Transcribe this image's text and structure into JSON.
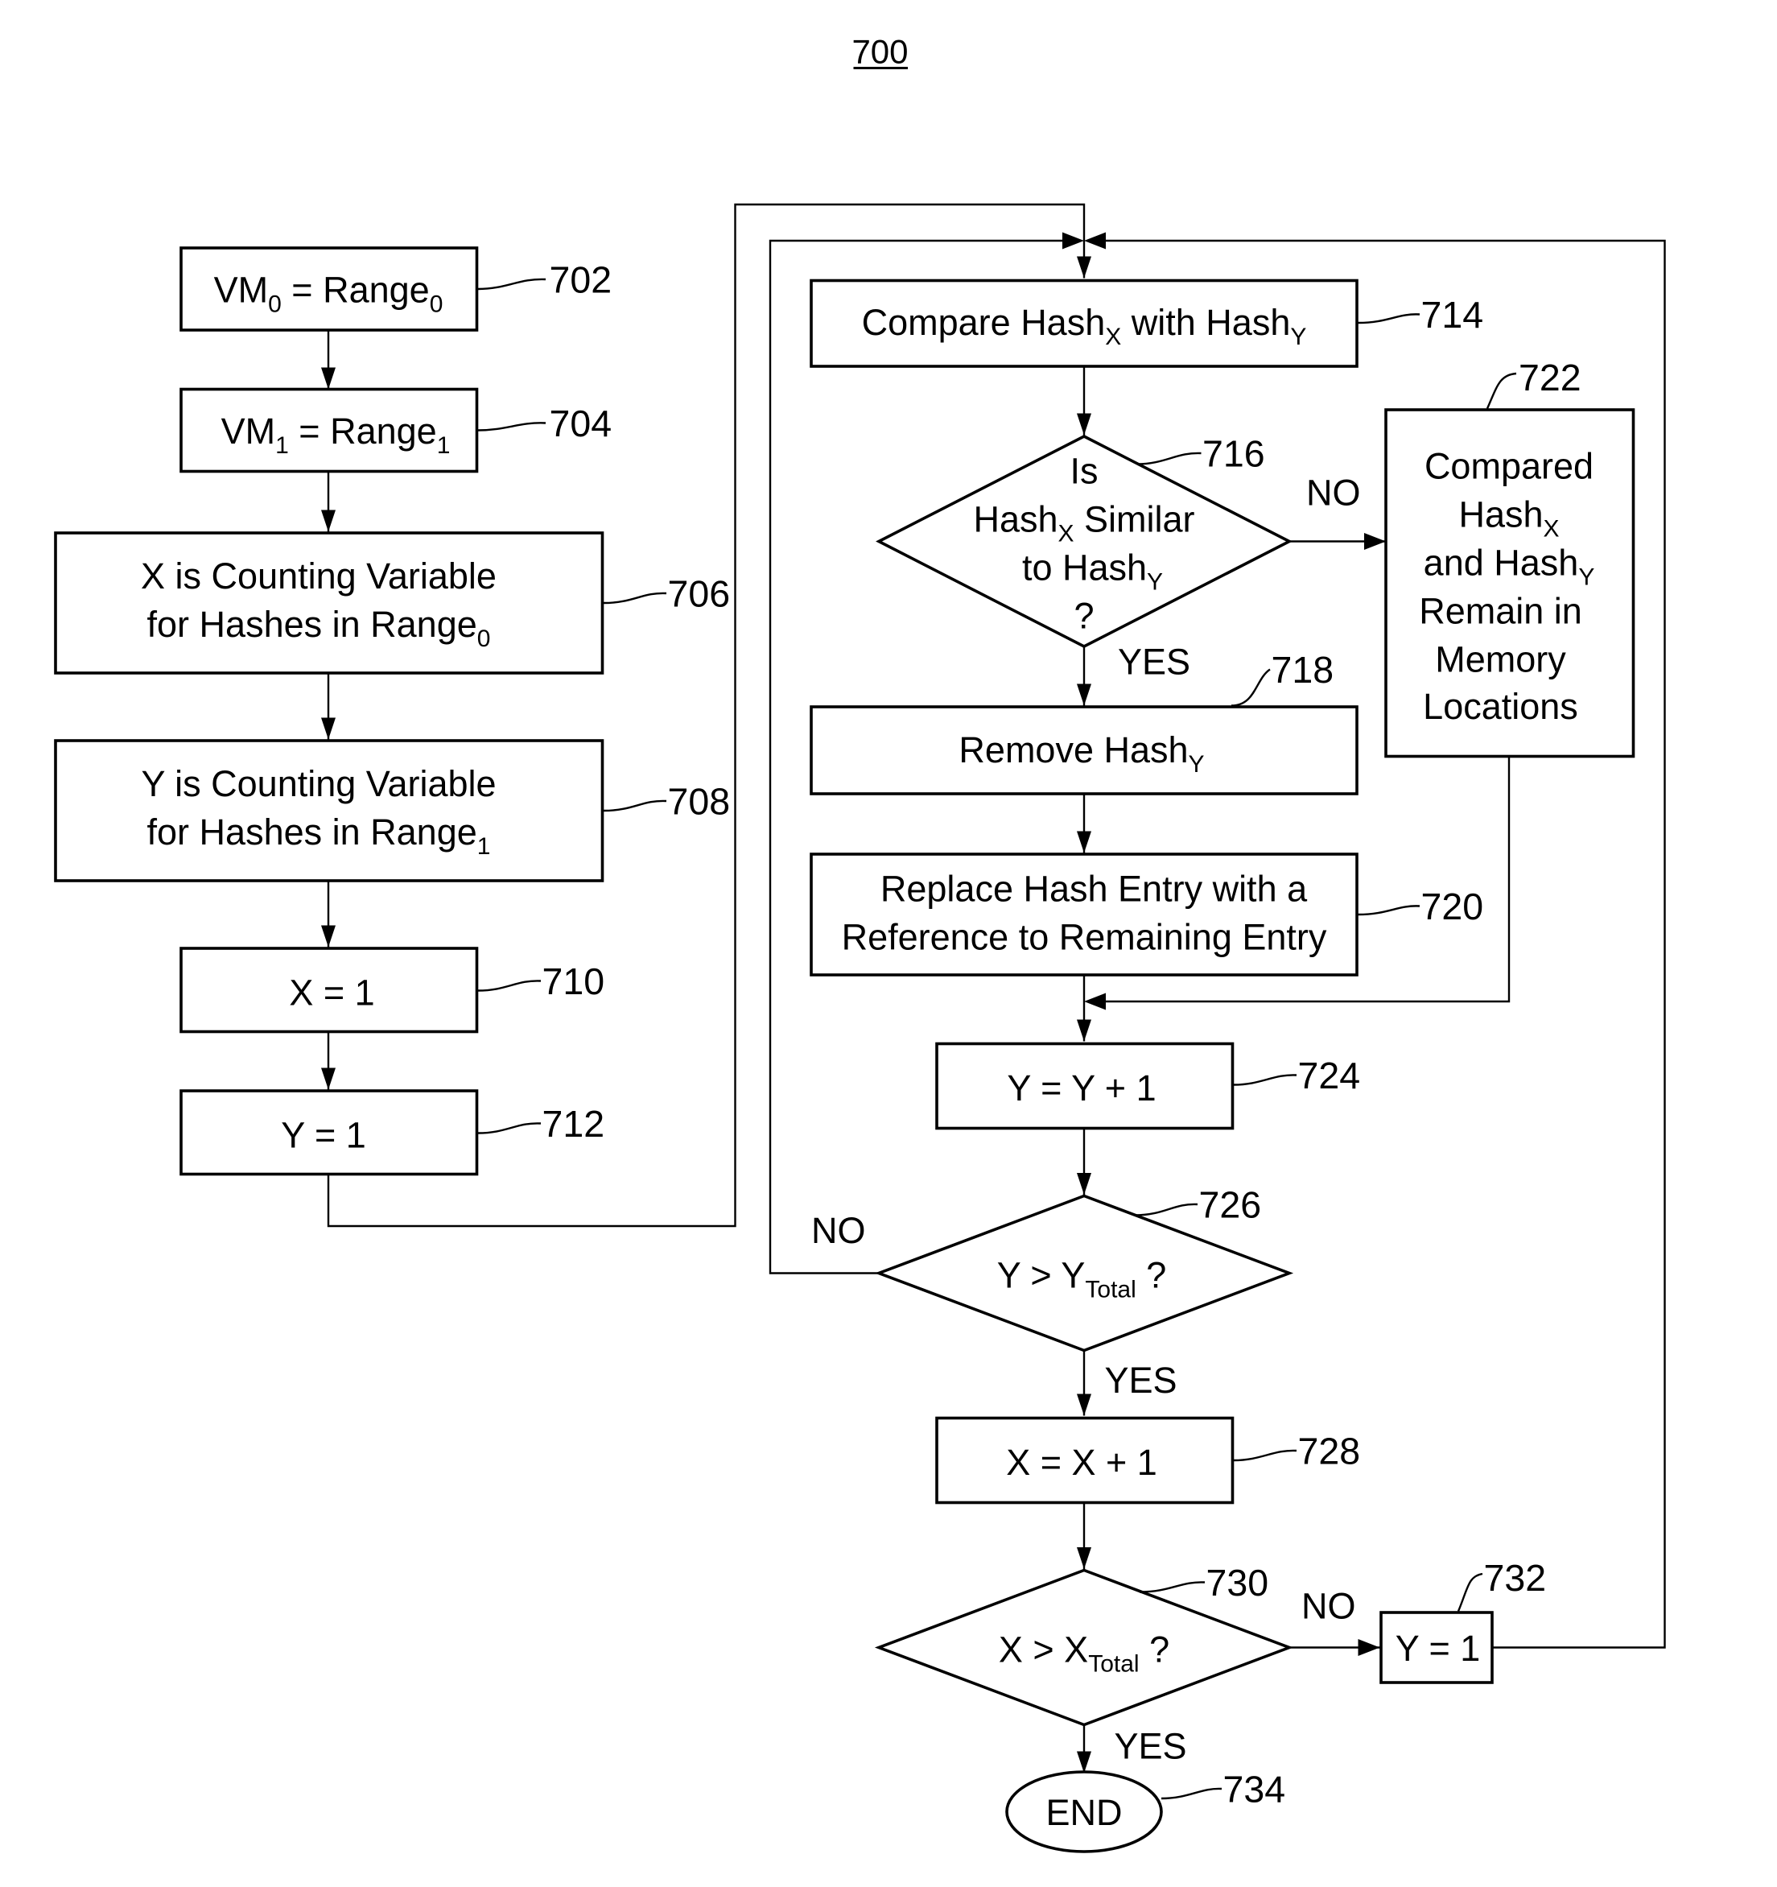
{
  "figure": {
    "number": "700"
  },
  "steps": {
    "s702": {
      "ref": "702",
      "text": "VM",
      "sub": "0",
      "text2": " = Range",
      "sub2": "0"
    },
    "s704": {
      "ref": "704",
      "text": "VM",
      "sub": "1",
      "text2": " = Range",
      "sub2": "1"
    },
    "s706": {
      "ref": "706",
      "line1": "X is Counting Variable",
      "line2": "for Hashes in Range",
      "sub": "0"
    },
    "s708": {
      "ref": "708",
      "line1": "Y is Counting Variable",
      "line2": "for Hashes in Range",
      "sub": "1"
    },
    "s710": {
      "ref": "710",
      "text": "X = 1"
    },
    "s712": {
      "ref": "712",
      "text": "Y = 1"
    },
    "s714": {
      "ref": "714",
      "text": "Compare Hash",
      "sub": "X",
      "text2": " with Hash",
      "sub2": "Y"
    },
    "s716": {
      "ref": "716",
      "line1": "Is",
      "line2": "Hash",
      "sub2": "X",
      "line2b": " Similar",
      "line3": "to Hash",
      "sub3": "Y",
      "line4": "?"
    },
    "s718": {
      "ref": "718",
      "text": "Remove Hash",
      "sub": "Y"
    },
    "s720": {
      "ref": "720",
      "line1": "Replace Hash Entry with a",
      "line2": "Reference to Remaining Entry"
    },
    "s722": {
      "ref": "722",
      "line1": "Compared",
      "line2": "Hash",
      "sub2": "X",
      "line3": "and Hash",
      "sub3": "Y",
      "line4": "Remain in",
      "line5": "Memory",
      "line6": "Locations"
    },
    "s724": {
      "ref": "724",
      "text": "Y = Y + 1"
    },
    "s726": {
      "ref": "726",
      "text": "Y > Y",
      "sub": "Total",
      "text2": " ?"
    },
    "s728": {
      "ref": "728",
      "text": "X = X + 1"
    },
    "s730": {
      "ref": "730",
      "text": "X > X",
      "sub": "Total",
      "text2": " ?"
    },
    "s732": {
      "ref": "732",
      "text": "Y = 1"
    },
    "s734": {
      "ref": "734",
      "text": "END"
    }
  },
  "branch_labels": {
    "yes": "YES",
    "no": "NO"
  }
}
